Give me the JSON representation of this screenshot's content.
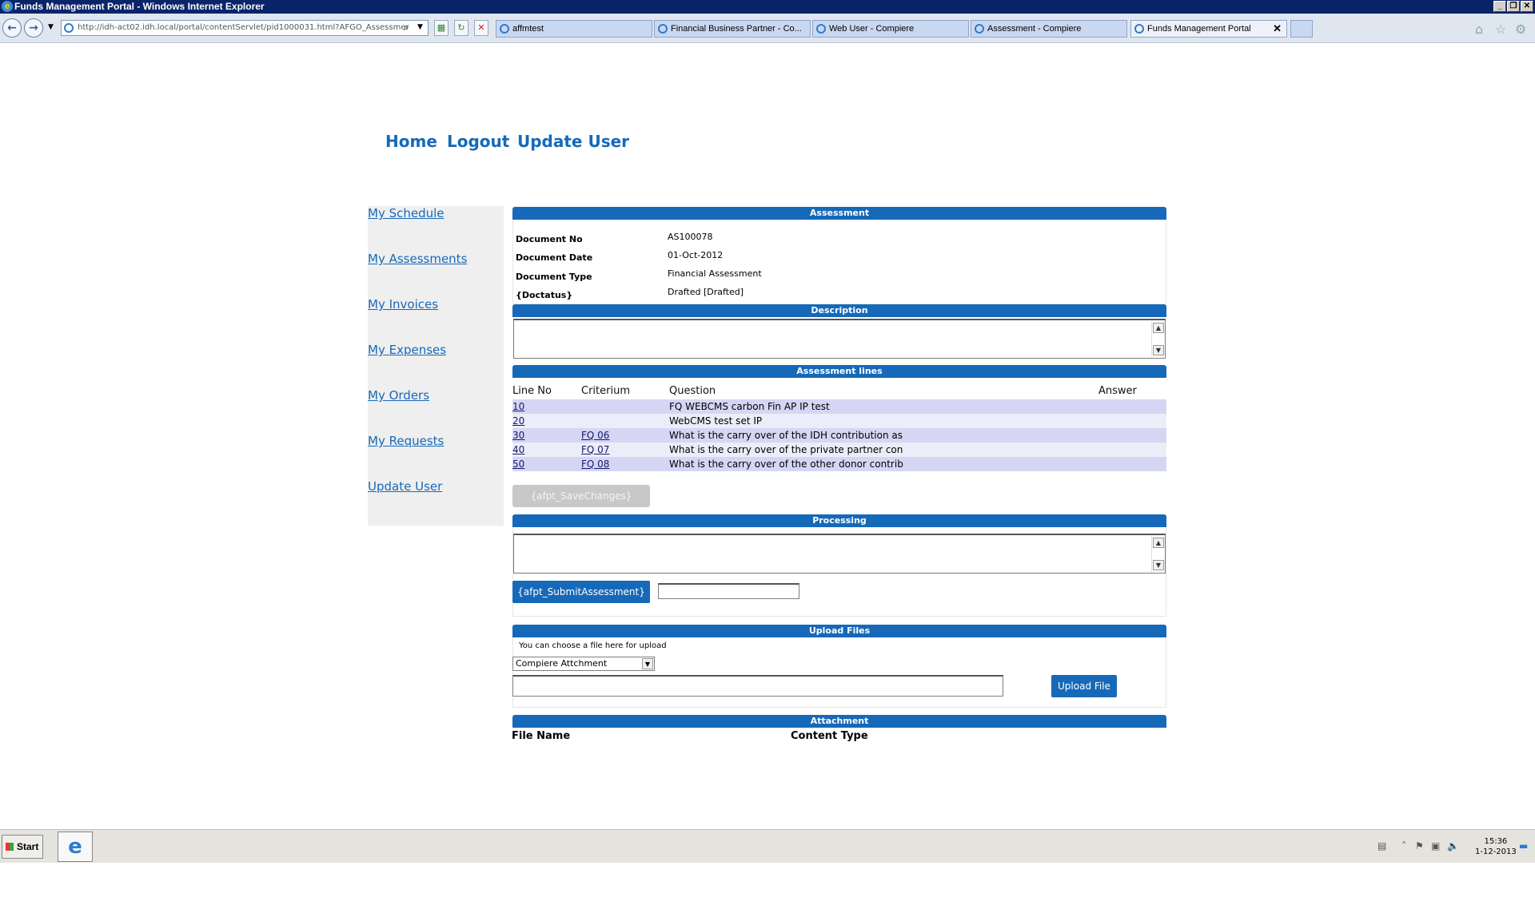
{
  "window": {
    "title": "Funds Management Portal - Windows Internet Explorer"
  },
  "browser": {
    "url": "http://idh-act02.idh.local/portal/contentServlet/pid1000031.html?AFGO_Assessmer",
    "tabs": [
      {
        "label": "affmtest"
      },
      {
        "label": "Financial Business Partner - Co..."
      },
      {
        "label": "Web User - Compiere"
      },
      {
        "label": "Assessment - Compiere"
      },
      {
        "label": "Funds Management Portal"
      }
    ]
  },
  "topnav": {
    "home": "Home",
    "logout": "Logout",
    "update_user": "Update User"
  },
  "sidebar": {
    "items": [
      {
        "label": "My Schedule"
      },
      {
        "label": "My Assessments"
      },
      {
        "label": "My Invoices"
      },
      {
        "label": "My Expenses"
      },
      {
        "label": "My Orders"
      },
      {
        "label": "My Requests"
      },
      {
        "label": "Update User"
      }
    ]
  },
  "assessment": {
    "header": "Assessment",
    "fields": [
      {
        "label": "Document No",
        "value": "AS100078"
      },
      {
        "label": "Document Date",
        "value": "01-Oct-2012"
      },
      {
        "label": "Document Type",
        "value": "Financial Assessment"
      },
      {
        "label": "{Doctatus}",
        "value": "Drafted [Drafted]"
      }
    ]
  },
  "description": {
    "header": "Description",
    "value": ""
  },
  "lines": {
    "header": "Assessment lines",
    "columns": [
      "Line No",
      "Criterium",
      "Question",
      "Answer"
    ],
    "rows": [
      {
        "line": "10",
        "criterium": "",
        "question": "FQ WEBCMS carbon Fin AP IP test",
        "answer": ""
      },
      {
        "line": "20",
        "criterium": "",
        "question": "WebCMS test set IP",
        "answer": ""
      },
      {
        "line": "30",
        "criterium": "FQ 06",
        "question": "What is the carry over of the IDH contribution as",
        "answer": ""
      },
      {
        "line": "40",
        "criterium": "FQ 07",
        "question": "What is the carry over of the private partner con",
        "answer": ""
      },
      {
        "line": "50",
        "criterium": "FQ 08",
        "question": "What is the carry over of the other donor contrib",
        "answer": ""
      }
    ],
    "save_label": "{afpt_SaveChanges}"
  },
  "processing": {
    "header": "Processing",
    "submit_label": "{afpt_SubmitAssessment}",
    "input_value": ""
  },
  "upload": {
    "header": "Upload Files",
    "hint": "You can choose a file here for upload",
    "select_value": "Compiere Attchment",
    "file_value": "",
    "button_label": "Upload File"
  },
  "attachment": {
    "header": "Attachment",
    "columns": [
      "File Name",
      "Content Type"
    ]
  },
  "taskbar": {
    "start_label": "Start",
    "time": "15:36",
    "date": "1-12-2013"
  },
  "colors": {
    "accent": "#1669b8",
    "row_odd": "#d6d6f4",
    "row_even": "#ededf9",
    "sidebar_bg": "#efefef"
  }
}
